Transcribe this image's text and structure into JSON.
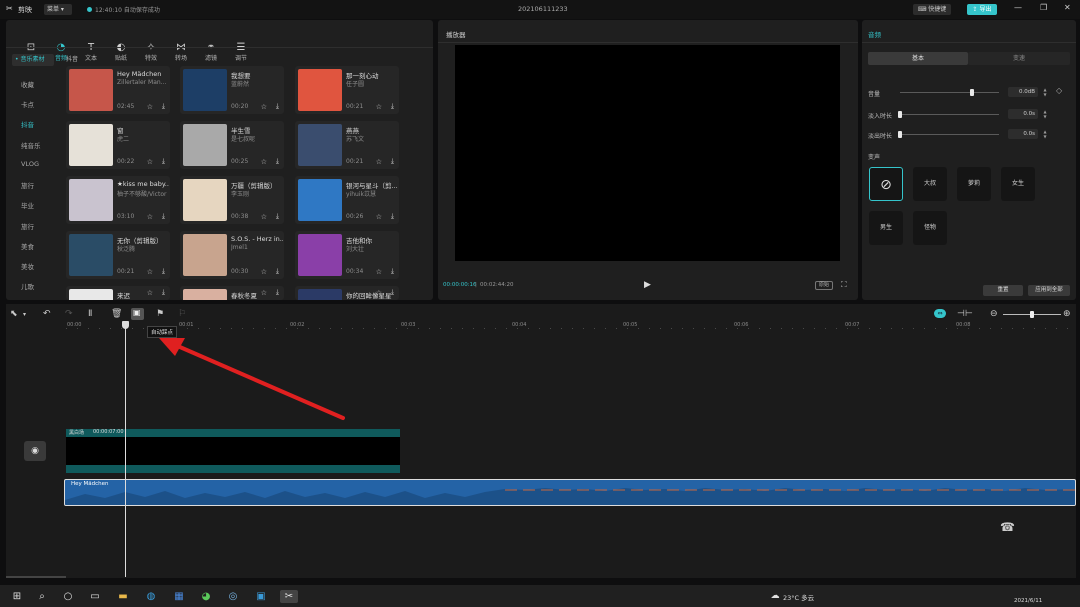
{
  "app": {
    "name": "剪映",
    "menu": "菜单",
    "autosave": "12:40:10 自动保存成功",
    "project": "202106111233",
    "shortcut": "快捷键",
    "export": "导出"
  },
  "toolbar": {
    "items": [
      {
        "label": "媒体",
        "icon": "media-icon"
      },
      {
        "label": "音频",
        "icon": "audio-icon"
      },
      {
        "label": "文本",
        "icon": "text-icon"
      },
      {
        "label": "贴纸",
        "icon": "sticker-icon"
      },
      {
        "label": "特效",
        "icon": "effects-icon"
      },
      {
        "label": "转场",
        "icon": "transition-icon"
      },
      {
        "label": "滤镜",
        "icon": "filter-icon"
      },
      {
        "label": "调节",
        "icon": "adjust-icon"
      }
    ]
  },
  "sidebar": {
    "header": "• 音乐素材",
    "items": [
      "收藏",
      "卡点",
      "抖音",
      "纯音乐",
      "VLOG",
      "旅行",
      "毕业",
      "旅行",
      "美食",
      "美妆",
      "儿歌"
    ]
  },
  "library": {
    "section": "抖音",
    "songs": [
      {
        "title": "Hey Mädchen",
        "artist": "Zillertaler Man...",
        "duration": "02:45",
        "thumb": "#c6564a"
      },
      {
        "title": "我想要",
        "artist": "蓝蔚然",
        "duration": "00:20",
        "thumb": "#1d3e66"
      },
      {
        "title": "那一刻心动",
        "artist": "任子圆",
        "duration": "00:21",
        "thumb": "#e0553f"
      },
      {
        "title": "窗",
        "artist": "虎二",
        "duration": "00:22",
        "thumb": "#e6e1d8"
      },
      {
        "title": "半生雪",
        "artist": "是七叔呢",
        "duration": "00:25",
        "thumb": "#a9a9a9"
      },
      {
        "title": "燕燕",
        "artist": "苏飞文",
        "duration": "00:21",
        "thumb": "#3a4d6e"
      },
      {
        "title": "★kiss me baby...",
        "artist": "柚子不够酸/Victor",
        "duration": "03:10",
        "thumb": "#c9c3cf"
      },
      {
        "title": "万疆（剪辑版）",
        "artist": "李玉刚",
        "duration": "00:38",
        "thumb": "#e6d6c0"
      },
      {
        "title": "银河与星斗（剪...",
        "artist": "yihuik苡慧",
        "duration": "00:26",
        "thumb": "#2f78c4"
      },
      {
        "title": "无你（剪辑版）",
        "artist": "秋泛腾",
        "duration": "00:21",
        "thumb": "#2a4c66"
      },
      {
        "title": "S.O.S. - Herz in...",
        "artist": "Jmel1",
        "duration": "00:30",
        "thumb": "#c8a48e"
      },
      {
        "title": "吉他和你",
        "artist": "刘大壮",
        "duration": "00:34",
        "thumb": "#8a3fa8"
      },
      {
        "title": "来迟",
        "artist": "",
        "duration": "",
        "thumb": "#e8e8e8"
      },
      {
        "title": "春秋冬夏",
        "artist": "",
        "duration": "",
        "thumb": "#d9b0a0"
      },
      {
        "title": "你的回眸像星星",
        "artist": "",
        "duration": "",
        "thumb": "#2b3a66"
      }
    ]
  },
  "player": {
    "title": "播放器",
    "current": "00:00:00:16",
    "total": "00:02:44:20",
    "ratio": "原始"
  },
  "audio_panel": {
    "title": "音频",
    "tabs": [
      "基本",
      "变速"
    ],
    "volume": {
      "label": "音量",
      "value": "0.0dB",
      "level": 0.73
    },
    "fadein": {
      "label": "淡入时长",
      "value": "0.0s",
      "level": 0
    },
    "fadeout": {
      "label": "淡出时长",
      "value": "0.0s",
      "level": 0
    },
    "voice_label": "变声",
    "voices": [
      "",
      "大叔",
      "萝莉",
      "女生",
      "男生",
      "怪物"
    ],
    "reset": "重置",
    "apply_all": "应用到全部"
  },
  "timeline": {
    "ticks": [
      "00:00",
      "00:01",
      "00:02",
      "00:03",
      "00:04",
      "00:05",
      "00:06",
      "00:07",
      "00:08"
    ],
    "tooltip": "自动踩点",
    "video_clip": {
      "label": "黑白场",
      "duration": "00:00:07:00"
    },
    "audio_clip": {
      "label": "Hey Mädchen"
    }
  },
  "taskbar": {
    "weather": "23°C 多云",
    "date": "2021/6/11"
  },
  "colors": {
    "accent": "#35c5cb",
    "audio_clip": "#2463a6",
    "video_clip": "#0f5a5c",
    "arrow": "#e02020"
  }
}
